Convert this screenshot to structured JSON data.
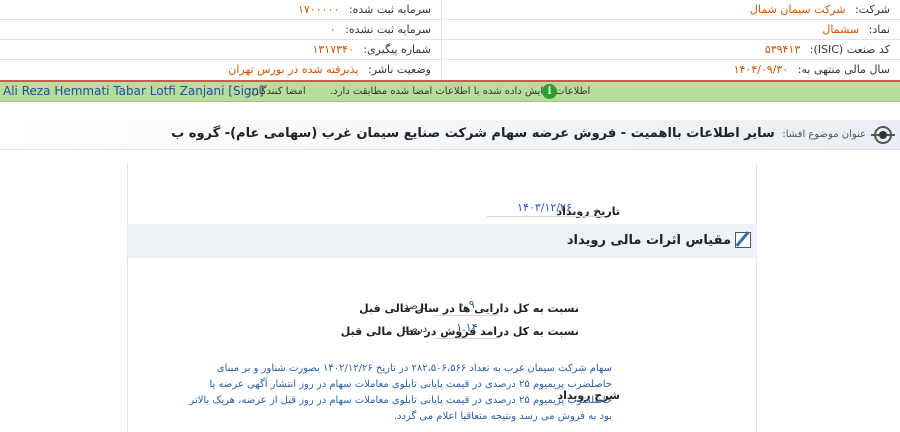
{
  "company_info": {
    "company_label": "شرکت:",
    "company_value": "شرکت سیمان شمال",
    "registered_capital_label": "سرمایه ثبت شده:",
    "registered_capital_value": "۱۷۰۰۰۰۰",
    "symbol_label": "نماد:",
    "symbol_value": "سشمال",
    "unregistered_capital_label": "سرمایه ثبت نشده:",
    "unregistered_capital_value": "۰",
    "isic_label": "کد صنعت (ISIC):",
    "isic_value": "۵۳۹۴۱۳",
    "tracking_label": "شماره پیگیری:",
    "tracking_value": "۱۳۱۷۳۴۰",
    "fiscal_year_label": "سال مالی منتهی به:",
    "fiscal_year_value": "۱۴۰۴/۰۹/۳۰",
    "publisher_status_label": "وضعیت ناشر:",
    "publisher_status_value": "پذیرفته شده در بورس تهران"
  },
  "signature_bar": {
    "notice": "اطلاعات نمایش داده شده با اطلاعات امضا شده مطابقت دارد.",
    "signers_label": "امضا کنندگان:",
    "signer_name": "Ali Reza Hemmati Tabar Lotfi Zanjani [Sign]",
    "info_glyph": "i"
  },
  "subject": {
    "label": "عنوان موضوع افشا:",
    "value": "سایر اطلاعات بااهمیت - فروش عرضه سهام شرکت صنایع سیمان غرب (سهامی عام)- گروه ب"
  },
  "event": {
    "date_label": "تاریخ رویداد",
    "date_value": "۱۴۰۳/۱۲/۲۶"
  },
  "financial_scale": {
    "title": "مقیاس اثرات مالی رویداد",
    "rows": [
      {
        "label": "نسبت به کل دارایی ها در سال مالی قبل",
        "value": "۰.۹",
        "unit": "درصد"
      },
      {
        "label": "نسبت به کل درامد فروش در سال مالی قبل",
        "value": "۱.۱۴",
        "unit": "درصد"
      }
    ]
  },
  "description": {
    "label": "شرح رویداد",
    "text": "سهام شرکت سیمان غرب به تعداد ۲۸۲،۵۰۶،۵۶۶ در تاریخ ۱۴۰۲/۱۲/۲۶ بصورت شناور و بر مبنای حاصلضرب پریمیوم ۲۵ درصدی در قیمت پایانی تابلوی معاملات سهام در روز انتشار آگهی عرضه یا حاصلضرب پریمیوم ۲۵ درصدی در قیمت پایانی تابلوی معاملات سهام در روز قبل از عرضه، هریک بالاتر بود به فروش می رسد ونتیجه متعاقبا اعلام می گردد."
  }
}
